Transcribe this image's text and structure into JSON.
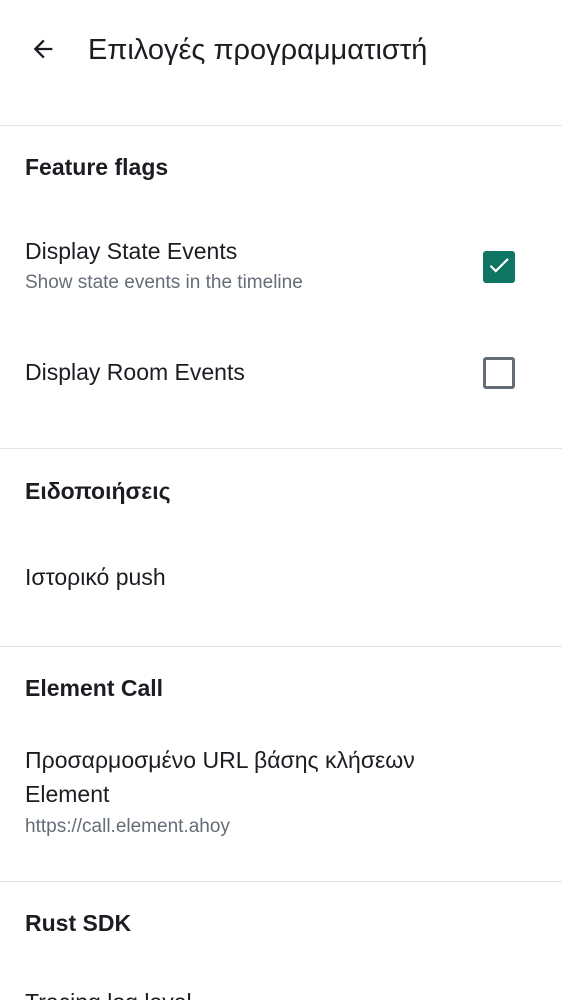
{
  "header": {
    "title": "Επιλογές προγραμματιστή",
    "back_icon": "arrow-back-icon"
  },
  "sections": {
    "feature_flags": {
      "title": "Feature flags",
      "items": [
        {
          "label": "Display State Events",
          "subtitle": "Show state events in the timeline",
          "checked": true
        },
        {
          "label": "Display Room Events",
          "checked": false
        }
      ]
    },
    "notifications": {
      "title": "Ειδοποιήσεις",
      "items": [
        {
          "label": "Ιστορικό push"
        }
      ]
    },
    "element_call": {
      "title": "Element Call",
      "items": [
        {
          "label": "Προσαρμοσμένο URL βάσης κλήσεων Element",
          "subtitle": "https://call.element.ahoy"
        }
      ]
    },
    "rust_sdk": {
      "title": "Rust SDK",
      "items": [
        {
          "label": "Tracing log level"
        }
      ]
    }
  },
  "colors": {
    "accent": "#0d7561",
    "text_primary": "#1b1d22",
    "text_secondary": "#656d77",
    "divider": "#e3e5e8",
    "background": "#ffffff"
  }
}
